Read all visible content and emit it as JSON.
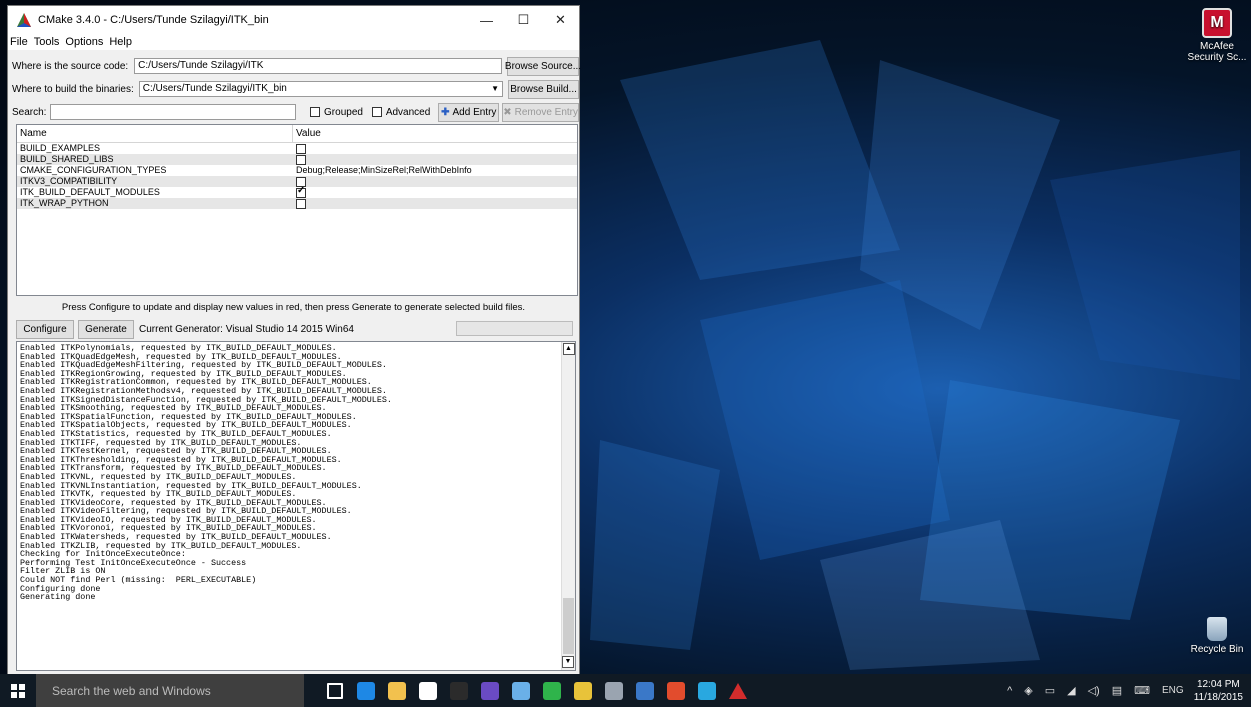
{
  "window": {
    "title": "CMake 3.4.0 - C:/Users/Tunde Szilagyi/ITK_bin",
    "minimize": "—",
    "maximize": "☐",
    "close": "✕"
  },
  "menu": [
    "File",
    "Tools",
    "Options",
    "Help"
  ],
  "source": {
    "label": "Where is the source code:",
    "value": "C:/Users/Tunde Szilagyi/ITK",
    "button": "Browse Source..."
  },
  "build": {
    "label": "Where to build the binaries:",
    "value": "C:/Users/Tunde Szilagyi/ITK_bin",
    "button": "Browse Build..."
  },
  "search": {
    "label": "Search:",
    "value": "",
    "grouped": "Grouped",
    "advanced": "Advanced",
    "add_entry": "Add Entry",
    "remove_entry": "Remove Entry"
  },
  "table": {
    "headers": {
      "name": "Name",
      "value": "Value"
    },
    "rows": [
      {
        "name": "BUILD_EXAMPLES",
        "type": "bool",
        "checked": false,
        "text": ""
      },
      {
        "name": "BUILD_SHARED_LIBS",
        "type": "bool",
        "checked": false,
        "text": ""
      },
      {
        "name": "CMAKE_CONFIGURATION_TYPES",
        "type": "text",
        "checked": false,
        "text": "Debug;Release;MinSizeRel;RelWithDebInfo"
      },
      {
        "name": "ITKV3_COMPATIBILITY",
        "type": "bool",
        "checked": false,
        "text": ""
      },
      {
        "name": "ITK_BUILD_DEFAULT_MODULES",
        "type": "bool",
        "checked": true,
        "text": ""
      },
      {
        "name": "ITK_WRAP_PYTHON",
        "type": "bool",
        "checked": false,
        "text": ""
      }
    ]
  },
  "hint": "Press Configure to update and display new values in red, then press Generate to generate selected build files.",
  "actions": {
    "configure": "Configure",
    "generate": "Generate",
    "generator": "Current Generator: Visual Studio 14 2015 Win64"
  },
  "log": [
    "Enabled ITKPolynomials, requested by ITK_BUILD_DEFAULT_MODULES.",
    "Enabled ITKQuadEdgeMesh, requested by ITK_BUILD_DEFAULT_MODULES.",
    "Enabled ITKQuadEdgeMeshFiltering, requested by ITK_BUILD_DEFAULT_MODULES.",
    "Enabled ITKRegionGrowing, requested by ITK_BUILD_DEFAULT_MODULES.",
    "Enabled ITKRegistrationCommon, requested by ITK_BUILD_DEFAULT_MODULES.",
    "Enabled ITKRegistrationMethodsv4, requested by ITK_BUILD_DEFAULT_MODULES.",
    "Enabled ITKSignedDistanceFunction, requested by ITK_BUILD_DEFAULT_MODULES.",
    "Enabled ITKSmoothing, requested by ITK_BUILD_DEFAULT_MODULES.",
    "Enabled ITKSpatialFunction, requested by ITK_BUILD_DEFAULT_MODULES.",
    "Enabled ITKSpatialObjects, requested by ITK_BUILD_DEFAULT_MODULES.",
    "Enabled ITKStatistics, requested by ITK_BUILD_DEFAULT_MODULES.",
    "Enabled ITKTIFF, requested by ITK_BUILD_DEFAULT_MODULES.",
    "Enabled ITKTestKernel, requested by ITK_BUILD_DEFAULT_MODULES.",
    "Enabled ITKThresholding, requested by ITK_BUILD_DEFAULT_MODULES.",
    "Enabled ITKTransform, requested by ITK_BUILD_DEFAULT_MODULES.",
    "Enabled ITKVNL, requested by ITK_BUILD_DEFAULT_MODULES.",
    "Enabled ITKVNLInstantiation, requested by ITK_BUILD_DEFAULT_MODULES.",
    "Enabled ITKVTK, requested by ITK_BUILD_DEFAULT_MODULES.",
    "Enabled ITKVideoCore, requested by ITK_BUILD_DEFAULT_MODULES.",
    "Enabled ITKVideoFiltering, requested by ITK_BUILD_DEFAULT_MODULES.",
    "Enabled ITKVideoIO, requested by ITK_BUILD_DEFAULT_MODULES.",
    "Enabled ITKVoronoi, requested by ITK_BUILD_DEFAULT_MODULES.",
    "Enabled ITKWatersheds, requested by ITK_BUILD_DEFAULT_MODULES.",
    "Enabled ITKZLIB, requested by ITK_BUILD_DEFAULT_MODULES.",
    "Checking for InitOnceExecuteOnce:",
    "Performing Test InitOnceExecuteOnce - Success",
    "Filter ZLIB is ON",
    "Could NOT find Perl (missing:  PERL_EXECUTABLE)",
    "Configuring done",
    "Generating done"
  ],
  "desktop": {
    "mcafee": "McAfee Security Sc...",
    "recycle": "Recycle Bin"
  },
  "taskbar": {
    "search_placeholder": "Search the web and Windows",
    "lang": "ENG",
    "time": "12:04 PM",
    "date": "11/18/2015",
    "apps": [
      {
        "name": "task-view",
        "color": "#ffffff"
      },
      {
        "name": "edge",
        "color": "#1e88e5"
      },
      {
        "name": "file-explorer",
        "color": "#f2c14e"
      },
      {
        "name": "store",
        "color": "#ffffff"
      },
      {
        "name": "kindle",
        "color": "#2b2b2b"
      },
      {
        "name": "save-app",
        "color": "#6a4bc4"
      },
      {
        "name": "app-circle",
        "color": "#6ab0e8"
      },
      {
        "name": "green-app",
        "color": "#2fb44b"
      },
      {
        "name": "chrome",
        "color": "#e8c33a"
      },
      {
        "name": "photos",
        "color": "#9aa4b0"
      },
      {
        "name": "puzzle-app",
        "color": "#3a78c8"
      },
      {
        "name": "office-app",
        "color": "#e24c2d"
      },
      {
        "name": "chat-app",
        "color": "#29a8e0"
      },
      {
        "name": "cmake-app",
        "color": "#d22c2c"
      }
    ]
  }
}
